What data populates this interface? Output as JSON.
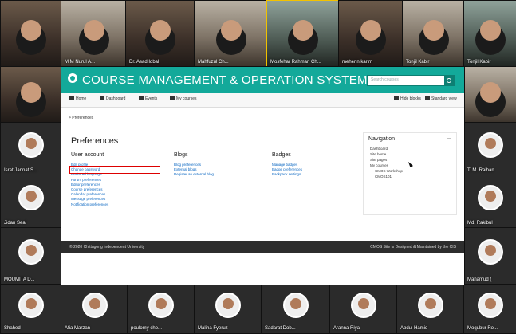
{
  "participants": {
    "top_row": [
      {
        "name": ""
      },
      {
        "name": "M M Nurul A..."
      },
      {
        "name": "Dr. Asad Iqbal"
      },
      {
        "name": "Mahfuzul Ch..."
      },
      {
        "name": "Mosfehar Rahman Ch..."
      },
      {
        "name": "meherin karim"
      },
      {
        "name": "Tonjil Kabir"
      },
      {
        "name": "Tonjil Kabir"
      }
    ],
    "left_col": [
      {
        "name": ""
      },
      {
        "name": "Israt Jannat S..."
      },
      {
        "name": "Jidan Seal"
      },
      {
        "name": "MOUMITA D..."
      }
    ],
    "right_col": [
      {
        "name": ""
      },
      {
        "name": "T. M. Raihan"
      },
      {
        "name": "Md. Rakibul"
      },
      {
        "name": "Mahamud ("
      }
    ],
    "bottom_row": [
      {
        "name": "Shahed"
      },
      {
        "name": "Afia Marzan"
      },
      {
        "name": "poulomy cho..."
      },
      {
        "name": "Maliha Fyeruz"
      },
      {
        "name": "Sadarat Dob..."
      },
      {
        "name": "Aranna Riya"
      },
      {
        "name": "Abdul Hamid"
      },
      {
        "name": "Moqubur Ro..."
      }
    ]
  },
  "lms": {
    "site_title": "COURSE MANAGEMENT & OPERATION SYSTEM",
    "search": {
      "placeholder": "Search courses"
    },
    "nav": {
      "home": "Home",
      "dashboard": "Dashboard",
      "events": "Events",
      "my_courses": "My courses",
      "hide_blocks": "Hide blocks",
      "standard_view": "Standard view"
    },
    "breadcrumb": "> Preferences",
    "page_title": "Preferences",
    "sections": {
      "user_account": {
        "title": "User account",
        "links": [
          "Edit profile",
          "Change password",
          "Preferred language",
          "Forum preferences",
          "Editor preferences",
          "Course preferences",
          "Calendar preferences",
          "Message preferences",
          "Notification preferences"
        ]
      },
      "blogs": {
        "title": "Blogs",
        "links": [
          "Blog preferences",
          "External blogs",
          "Register an external blog"
        ]
      },
      "badges": {
        "title": "Badges",
        "links": [
          "Manage badges",
          "Badge preferences",
          "Backpack settings"
        ]
      }
    },
    "navigation": {
      "title": "Navigation",
      "items": [
        "Dashboard",
        "Site home",
        "Site pages",
        "My courses",
        "CMOS Workshop",
        "CMOS101"
      ]
    },
    "footer": {
      "left": "© 2020 Chittagong Independent University",
      "right": "CMOS Site is Designed & Maintained by the CIS"
    }
  },
  "colors": {
    "teal": "#13a99a",
    "teal_dark": "#0d7f73",
    "highlight": "#f2c200"
  }
}
